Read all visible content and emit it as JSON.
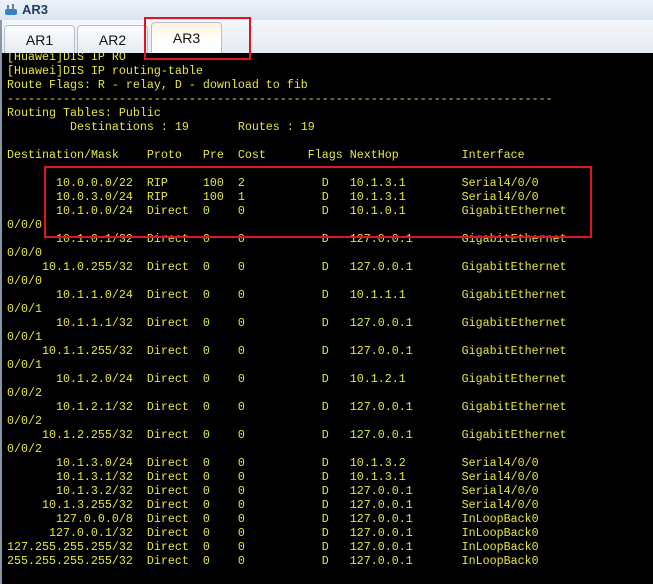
{
  "window": {
    "title": "AR3"
  },
  "tabs": [
    {
      "label": "AR1"
    },
    {
      "label": "AR2"
    },
    {
      "label": "AR3",
      "active": true
    }
  ],
  "terminal": {
    "preamble": [
      "[Huawei]DIS IP RO",
      "[Huawei]DIS IP routing-table",
      "Route Flags: R - relay, D - download to fib",
      "------------------------------------------------------------------------------",
      "Routing Tables: Public",
      "         Destinations : 19       Routes : 19",
      ""
    ],
    "header": {
      "dest": "Destination/Mask",
      "proto": "Proto",
      "pre": "Pre",
      "cost": "Cost",
      "flags": "Flags",
      "nexthop": "NextHop",
      "iface": "Interface"
    },
    "routes": [
      {
        "dest": "10.0.0.0/22",
        "proto": "RIP",
        "pre": "100",
        "cost": "2",
        "flags": "D",
        "nexthop": "10.1.3.1",
        "iface": "Serial4/0/0",
        "wrap": ""
      },
      {
        "dest": "10.0.3.0/24",
        "proto": "RIP",
        "pre": "100",
        "cost": "1",
        "flags": "D",
        "nexthop": "10.1.3.1",
        "iface": "Serial4/0/0",
        "wrap": ""
      },
      {
        "dest": "10.1.0.0/24",
        "proto": "Direct",
        "pre": "0",
        "cost": "0",
        "flags": "D",
        "nexthop": "10.1.0.1",
        "iface": "GigabitEthernet",
        "wrap": "0/0/0"
      },
      {
        "dest": "10.1.0.1/32",
        "proto": "Direct",
        "pre": "0",
        "cost": "0",
        "flags": "D",
        "nexthop": "127.0.0.1",
        "iface": "GigabitEthernet",
        "wrap": "0/0/0"
      },
      {
        "dest": "10.1.0.255/32",
        "proto": "Direct",
        "pre": "0",
        "cost": "0",
        "flags": "D",
        "nexthop": "127.0.0.1",
        "iface": "GigabitEthernet",
        "wrap": "0/0/0"
      },
      {
        "dest": "10.1.1.0/24",
        "proto": "Direct",
        "pre": "0",
        "cost": "0",
        "flags": "D",
        "nexthop": "10.1.1.1",
        "iface": "GigabitEthernet",
        "wrap": "0/0/1"
      },
      {
        "dest": "10.1.1.1/32",
        "proto": "Direct",
        "pre": "0",
        "cost": "0",
        "flags": "D",
        "nexthop": "127.0.0.1",
        "iface": "GigabitEthernet",
        "wrap": "0/0/1"
      },
      {
        "dest": "10.1.1.255/32",
        "proto": "Direct",
        "pre": "0",
        "cost": "0",
        "flags": "D",
        "nexthop": "127.0.0.1",
        "iface": "GigabitEthernet",
        "wrap": "0/0/1"
      },
      {
        "dest": "10.1.2.0/24",
        "proto": "Direct",
        "pre": "0",
        "cost": "0",
        "flags": "D",
        "nexthop": "10.1.2.1",
        "iface": "GigabitEthernet",
        "wrap": "0/0/2"
      },
      {
        "dest": "10.1.2.1/32",
        "proto": "Direct",
        "pre": "0",
        "cost": "0",
        "flags": "D",
        "nexthop": "127.0.0.1",
        "iface": "GigabitEthernet",
        "wrap": "0/0/2"
      },
      {
        "dest": "10.1.2.255/32",
        "proto": "Direct",
        "pre": "0",
        "cost": "0",
        "flags": "D",
        "nexthop": "127.0.0.1",
        "iface": "GigabitEthernet",
        "wrap": "0/0/2"
      },
      {
        "dest": "10.1.3.0/24",
        "proto": "Direct",
        "pre": "0",
        "cost": "0",
        "flags": "D",
        "nexthop": "10.1.3.2",
        "iface": "Serial4/0/0",
        "wrap": ""
      },
      {
        "dest": "10.1.3.1/32",
        "proto": "Direct",
        "pre": "0",
        "cost": "0",
        "flags": "D",
        "nexthop": "10.1.3.1",
        "iface": "Serial4/0/0",
        "wrap": ""
      },
      {
        "dest": "10.1.3.2/32",
        "proto": "Direct",
        "pre": "0",
        "cost": "0",
        "flags": "D",
        "nexthop": "127.0.0.1",
        "iface": "Serial4/0/0",
        "wrap": ""
      },
      {
        "dest": "10.1.3.255/32",
        "proto": "Direct",
        "pre": "0",
        "cost": "0",
        "flags": "D",
        "nexthop": "127.0.0.1",
        "iface": "Serial4/0/0",
        "wrap": ""
      },
      {
        "dest": "127.0.0.0/8",
        "proto": "Direct",
        "pre": "0",
        "cost": "0",
        "flags": "D",
        "nexthop": "127.0.0.1",
        "iface": "InLoopBack0",
        "wrap": ""
      },
      {
        "dest": "127.0.0.1/32",
        "proto": "Direct",
        "pre": "0",
        "cost": "0",
        "flags": "D",
        "nexthop": "127.0.0.1",
        "iface": "InLoopBack0",
        "wrap": ""
      },
      {
        "dest": "127.255.255.255/32",
        "proto": "Direct",
        "pre": "0",
        "cost": "0",
        "flags": "D",
        "nexthop": "127.0.0.1",
        "iface": "InLoopBack0",
        "wrap": ""
      },
      {
        "dest": "255.255.255.255/32",
        "proto": "Direct",
        "pre": "0",
        "cost": "0",
        "flags": "D",
        "nexthop": "127.0.0.1",
        "iface": "InLoopBack0",
        "wrap": ""
      }
    ]
  },
  "colors": {
    "terminal_text": "#e6e63c",
    "highlight": "#e0141c"
  }
}
